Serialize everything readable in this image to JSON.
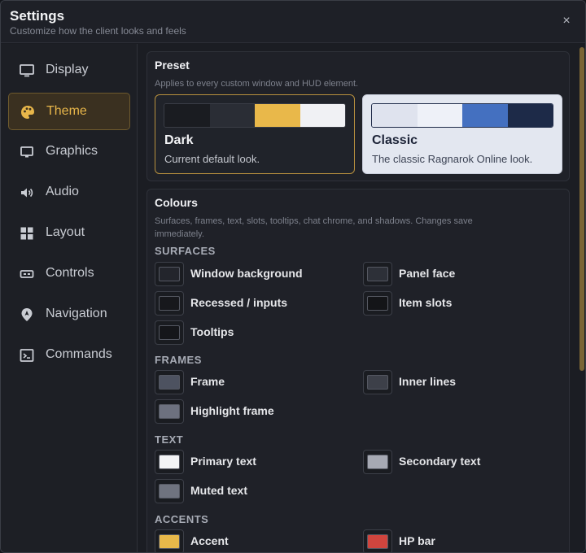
{
  "window": {
    "title": "Settings",
    "subtitle": "Customize how the client looks and feels",
    "close_label": "×"
  },
  "sidebar": {
    "items": [
      {
        "label": "Display",
        "icon": "monitor-icon",
        "active": false
      },
      {
        "label": "Theme",
        "icon": "palette-icon",
        "active": true
      },
      {
        "label": "Graphics",
        "icon": "screen-icon",
        "active": false
      },
      {
        "label": "Audio",
        "icon": "speaker-icon",
        "active": false
      },
      {
        "label": "Layout",
        "icon": "grid-icon",
        "active": false
      },
      {
        "label": "Controls",
        "icon": "gamepad-icon",
        "active": false
      },
      {
        "label": "Navigation",
        "icon": "location-icon",
        "active": false
      },
      {
        "label": "Commands",
        "icon": "terminal-icon",
        "active": false
      }
    ]
  },
  "preset": {
    "title": "Preset",
    "description": "Applies to every custom window and HUD element.",
    "options": [
      {
        "name": "Dark",
        "description": "Current default look.",
        "selected": true,
        "swatches": [
          "#1a1c21",
          "#2a2d35",
          "#e9b84a",
          "#f0f1f4"
        ]
      },
      {
        "name": "Classic",
        "description": "The classic Ragnarok Online look.",
        "selected": false,
        "swatches": [
          "#dfe3ee",
          "#eef1f8",
          "#4470c0",
          "#1d2a48"
        ]
      }
    ]
  },
  "colours": {
    "title": "Colours",
    "description": "Surfaces, frames, text, slots, tooltips, chat chrome, and shadows. Changes save immediately.",
    "sections": [
      {
        "heading": "SURFACES",
        "items": [
          {
            "label": "Window background",
            "color": "#23252c"
          },
          {
            "label": "Panel face",
            "color": "#2d3038"
          },
          {
            "label": "Recessed / inputs",
            "color": "#17181c"
          },
          {
            "label": "Item slots",
            "color": "#141518"
          },
          {
            "label": "Tooltips",
            "color": "#15161a"
          }
        ]
      },
      {
        "heading": "FRAMES",
        "items": [
          {
            "label": "Frame",
            "color": "#4d5260"
          },
          {
            "label": "Inner lines",
            "color": "#3d4049"
          },
          {
            "label": "Highlight frame",
            "color": "#6d717f"
          }
        ]
      },
      {
        "heading": "TEXT",
        "items": [
          {
            "label": "Primary text",
            "color": "#f3f4f6"
          },
          {
            "label": "Secondary text",
            "color": "#a6a9b3"
          },
          {
            "label": "Muted text",
            "color": "#6f737f"
          }
        ]
      },
      {
        "heading": "ACCENTS",
        "items": [
          {
            "label": "Accent",
            "color": "#e8b84a"
          },
          {
            "label": "HP bar",
            "color": "#d0453e"
          }
        ]
      }
    ]
  }
}
